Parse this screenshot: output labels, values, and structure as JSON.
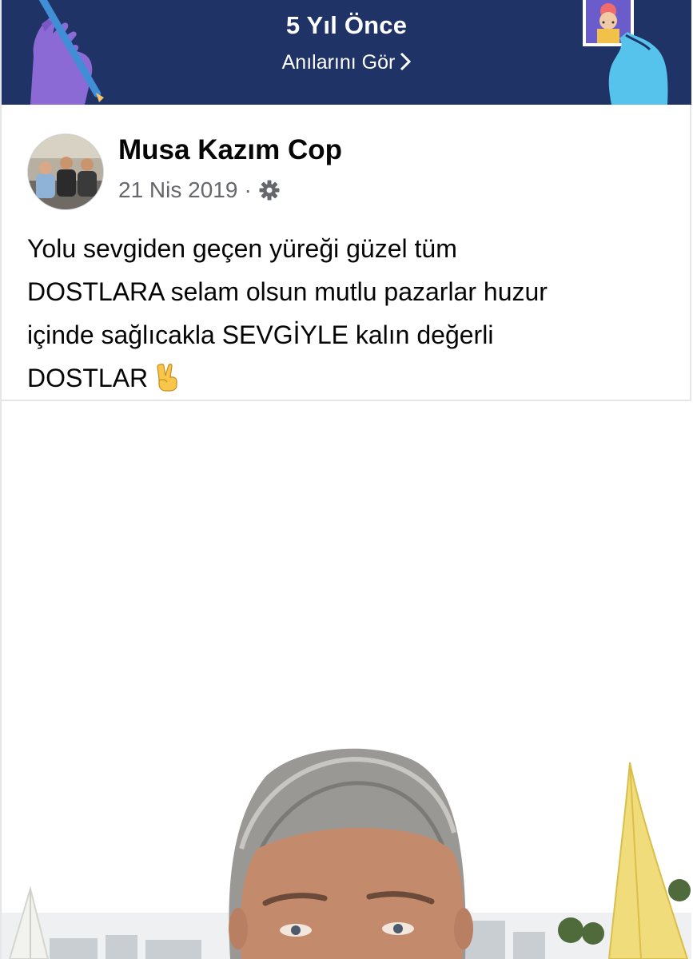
{
  "memory_banner": {
    "title": "5 Yıl Önce",
    "link_label": "Anılarını Gör",
    "background_color": "#1f3366",
    "left_decoration_icon": "hand-with-pencil-illustration",
    "right_decoration_icon": "hand-holding-photo-illustration",
    "link_icon": "chevron-right-icon"
  },
  "post": {
    "author": "Musa Kazım Cop",
    "date": "21 Nis 2019",
    "separator": "·",
    "privacy_icon": "gear-icon",
    "text_lines": [
      "Yolu sevgiden geçen yüreği güzel tüm",
      "DOSTLARA selam olsun mutlu pazarlar huzur",
      "içinde sağlıcakla SEVGİYLE kalın değerli",
      "DOSTLAR"
    ],
    "emoji": "✌",
    "photo_description_icon": "selfie-photo"
  },
  "colors": {
    "text_primary": "#050505",
    "text_secondary": "#65676b",
    "divider": "#e4e6ea"
  }
}
